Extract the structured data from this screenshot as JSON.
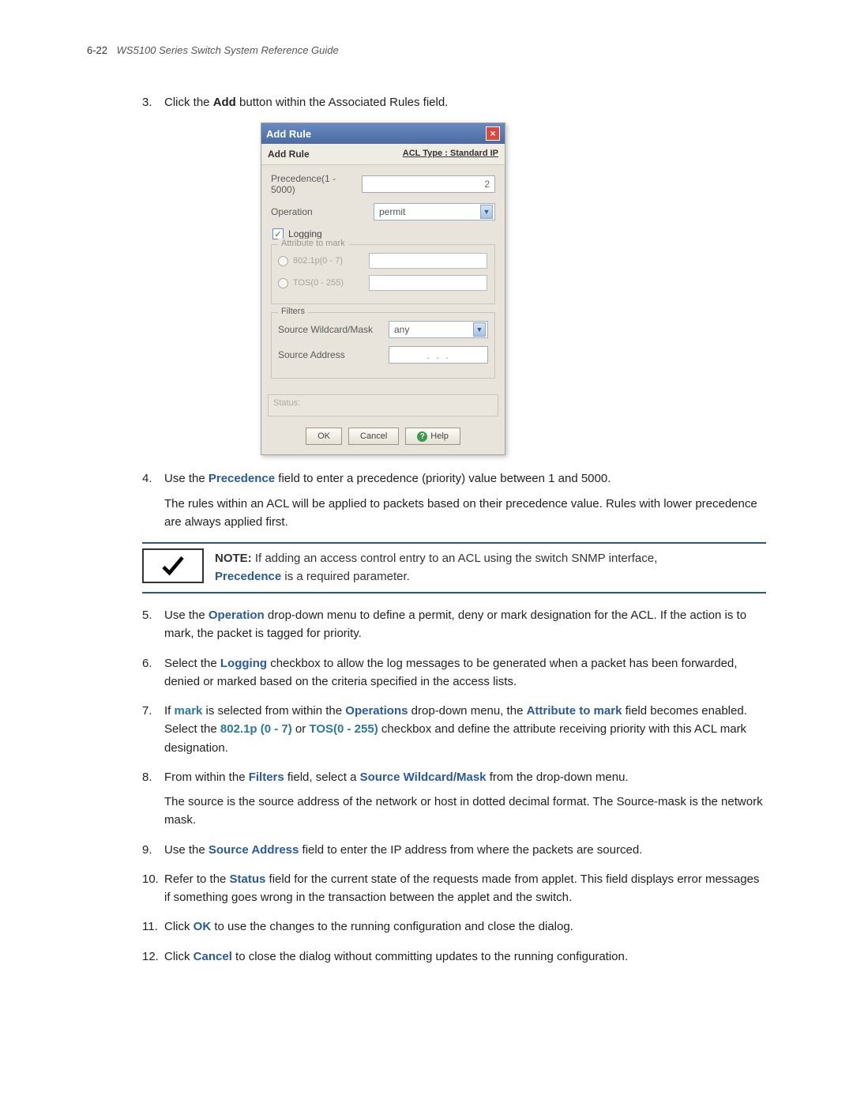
{
  "header": {
    "page_num": "6-22",
    "title": "WS5100 Series Switch System Reference Guide"
  },
  "steps": {
    "s3": {
      "num": "3.",
      "text_pre": "Click the ",
      "add": "Add",
      "text_post": " button within the Associated Rules field."
    },
    "s4": {
      "num": "4.",
      "text_pre": "Use the ",
      "precedence": "Precedence",
      "text_post": " field to enter a precedence (priority) value between 1 and 5000.",
      "para": "The rules within an ACL will be applied to packets based on their precedence value. Rules with lower precedence are always applied first."
    },
    "s5": {
      "num": "5.",
      "pre": "Use the ",
      "op": "Operation",
      "post": " drop-down menu to define a permit, deny or mark designation for the ACL. If the action is to mark, the packet is tagged for priority."
    },
    "s6": {
      "num": "6.",
      "pre": "Select the ",
      "log": "Logging",
      "post": " checkbox to allow the log messages to be generated when a packet has been forwarded, denied or marked based on the criteria specified in the access lists."
    },
    "s7": {
      "num": "7.",
      "pre": "If ",
      "mark": "mark",
      "mid1": " is selected from within the ",
      "ops": "Operations",
      "mid2": " drop-down menu, the ",
      "attr": "Attribute to mark",
      "mid3": " field becomes enabled. Select the ",
      "p802": "802.1p (0 - 7)",
      "or": " or ",
      "tos": "TOS(0 - 255)",
      "post": " checkbox and define the attribute receiving priority with this ACL mark designation."
    },
    "s8": {
      "num": "8.",
      "pre": "From within the ",
      "filters": "Filters",
      "mid": " field, select a ",
      "swm": "Source Wildcard/Mask",
      "post": " from the drop-down menu.",
      "para": "The source is the source address of the network or host in dotted decimal format. The Source-mask is the network mask."
    },
    "s9": {
      "num": "9.",
      "pre": "Use the ",
      "sa": "Source Address",
      "post": " field to enter the IP address from where the packets are sourced."
    },
    "s10": {
      "num": "10.",
      "pre": "Refer to the ",
      "status": "Status",
      "post": " field for the current state of the requests made from applet. This field displays error messages if something goes wrong in the transaction between the applet and the switch."
    },
    "s11": {
      "num": "11.",
      "pre": "Click ",
      "ok": "OK",
      "post": " to use the changes to the running configuration and close the dialog."
    },
    "s12": {
      "num": "12.",
      "pre": "Click ",
      "cancel": "Cancel",
      "post": " to close the dialog without committing updates to the running configuration."
    }
  },
  "note": {
    "label": "NOTE:",
    "text1": " If adding an access control entry to an ACL using the switch SNMP interface, ",
    "precedence": "Precedence",
    "text2": " is a required parameter."
  },
  "dialog": {
    "title": "Add Rule",
    "subhead_left": "Add Rule",
    "subhead_right": "ACL Type : Standard IP",
    "precedence_label": "Precedence(1 - 5000)",
    "precedence_value": "2",
    "operation_label": "Operation",
    "operation_value": "permit",
    "logging_label": "Logging",
    "attr_legend": "Attribute to mark",
    "attr_8021p": "802.1p(0 - 7)",
    "attr_tos": "TOS(0 - 255)",
    "filters_legend": "Filters",
    "swm_label": "Source Wildcard/Mask",
    "swm_value": "any",
    "sa_label": "Source Address",
    "ip_dots": ".     .     .",
    "status_label": "Status:",
    "btn_ok": "OK",
    "btn_cancel": "Cancel",
    "btn_help": "Help"
  }
}
